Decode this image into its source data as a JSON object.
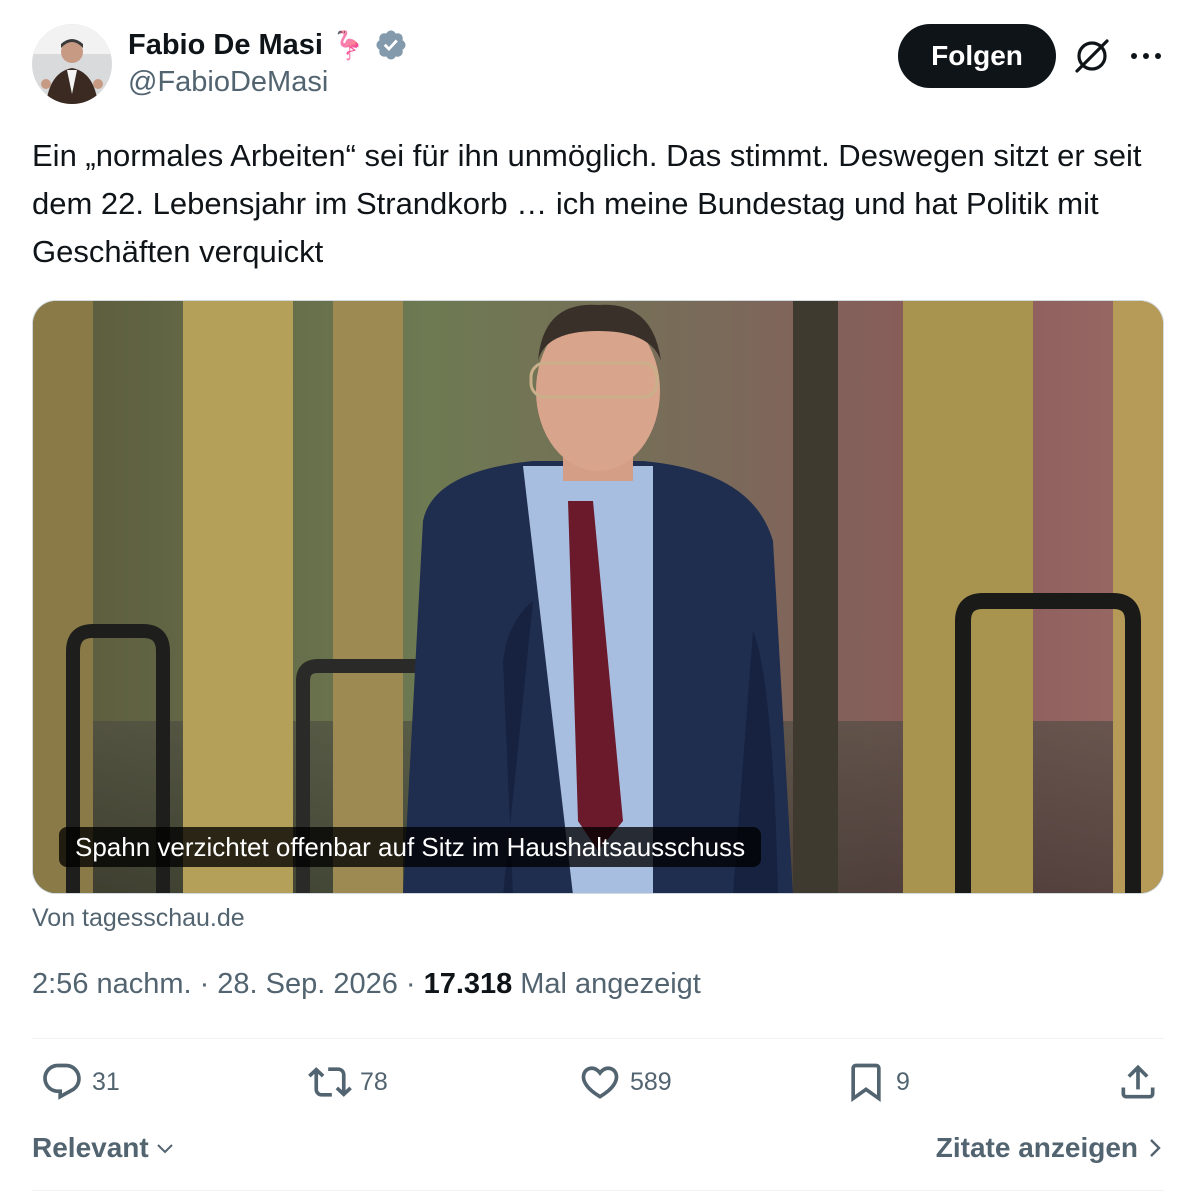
{
  "author": {
    "display_name": "Fabio De Masi",
    "emoji": "🦩",
    "handle": "@FabioDeMasi"
  },
  "follow_label": "Folgen",
  "tweet_text": "Ein „normales Arbeiten“ sei für ihn unmöglich. Das stimmt. Deswegen sitzt er seit dem 22. Lebensjahr im Strandkorb … ich meine Bundestag und hat Politik mit Geschäften verquickt",
  "card": {
    "caption": "Spahn verzichtet offenbar auf Sitz im Haushaltsausschuss",
    "source": "Von tagesschau.de"
  },
  "meta": {
    "time": "2:56 nachm.",
    "separator": "·",
    "date": "28. Sep. 2026",
    "views_count": "17.318",
    "views_label": "Mal angezeigt"
  },
  "actions": {
    "replies": "31",
    "reposts": "78",
    "likes": "589",
    "bookmarks": "9"
  },
  "sort_label": "Relevant",
  "quotes_label": "Zitate anzeigen",
  "colors": {
    "primary_text": "#0f1419",
    "secondary_text": "#536471",
    "verified_badge": "#829aab",
    "button_bg": "#0f1419"
  },
  "icons": [
    "verified-badge-icon",
    "grok-icon",
    "more-icon",
    "reply-icon",
    "repost-icon",
    "like-icon",
    "bookmark-icon",
    "share-icon",
    "chevron-down-icon",
    "chevron-right-icon"
  ]
}
